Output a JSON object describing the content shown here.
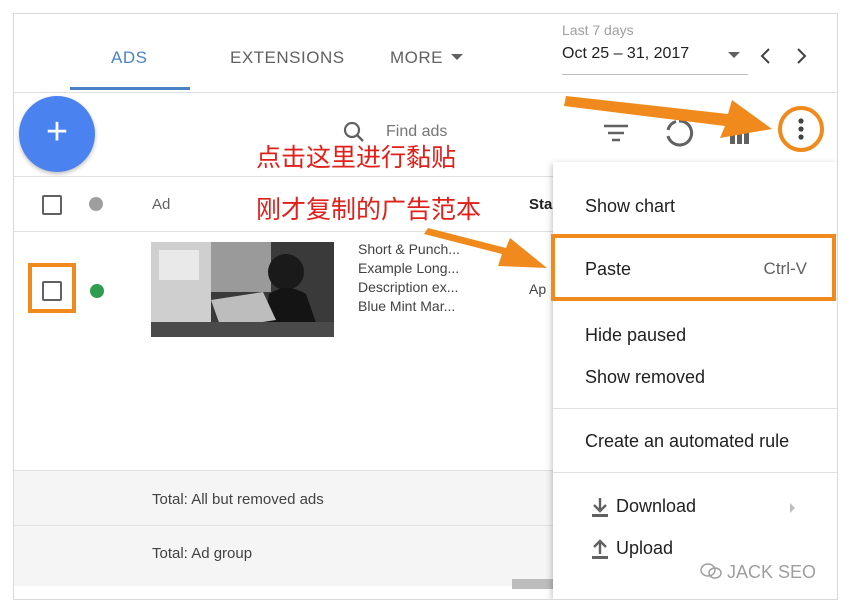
{
  "tabs": [
    {
      "label": "ADS",
      "active": true
    },
    {
      "label": "EXTENSIONS",
      "active": false
    },
    {
      "label": "MORE",
      "active": false
    }
  ],
  "date_range": {
    "caption": "Last 7 days",
    "value": "Oct 25 – 31, 2017"
  },
  "toolbar": {
    "add_label": "+",
    "search_placeholder": "Find ads"
  },
  "table": {
    "headers": {
      "ad": "Ad",
      "status": "Sta"
    },
    "rows": [
      {
        "ad_lines": [
          "Short & Punch...",
          "Example Long...",
          "Description ex...",
          "Blue Mint Mar..."
        ],
        "status": "Ap",
        "status_color": "#2e9d4f"
      }
    ],
    "totals": [
      "Total: All but removed ads",
      "Total: Ad group"
    ]
  },
  "menu": {
    "items": [
      {
        "label": "Show chart"
      },
      {
        "label": "Paste",
        "shortcut": "Ctrl-V"
      },
      {
        "label": "Hide paused"
      },
      {
        "label": "Show removed"
      },
      {
        "label": "Create an automated rule"
      },
      {
        "label": "Download",
        "icon": "download-icon"
      },
      {
        "label": "Upload",
        "icon": "upload-icon"
      }
    ]
  },
  "annotations": {
    "click_here": "点击这里进行黏贴",
    "copied_template": "刚才复制的广告范本"
  },
  "watermark": "JACK SEO",
  "colors": {
    "accent": "#4a83c4",
    "fab": "#4a83f0",
    "highlight": "#f08a1c",
    "annotation_text": "#e0201b"
  }
}
